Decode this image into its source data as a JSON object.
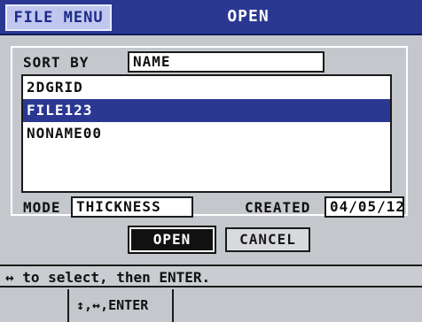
{
  "header": {
    "menu_tab": "FILE MENU",
    "title": "OPEN"
  },
  "sort": {
    "label": "SORT BY",
    "value": "NAME"
  },
  "files": [
    {
      "name": "2DGRID",
      "selected": false
    },
    {
      "name": "FILE123",
      "selected": true
    },
    {
      "name": "NONAME00",
      "selected": false
    }
  ],
  "details": {
    "mode_label": "MODE",
    "mode_value": "THICKNESS",
    "created_label": "CREATED",
    "created_value": "04/05/12"
  },
  "buttons": {
    "open_label": "OPEN",
    "cancel_label": "CANCEL"
  },
  "help": {
    "hint": "↔ to select, then ENTER.",
    "keys": "↕,↔,ENTER"
  },
  "colors": {
    "title_bar": "#2b3892",
    "selection": "#2b3892",
    "background": "#c4c7cb"
  }
}
